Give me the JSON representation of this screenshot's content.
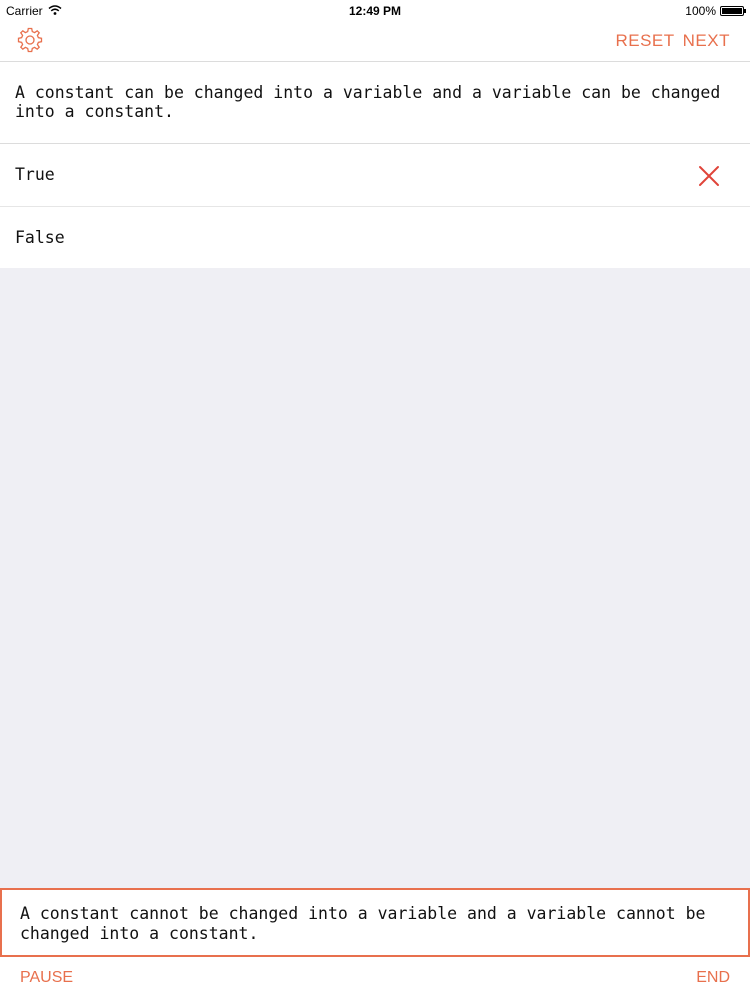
{
  "status_bar": {
    "carrier": "Carrier",
    "time": "12:49 PM",
    "battery": "100%"
  },
  "nav": {
    "settings_icon": "gear-icon",
    "reset_label": "RESET",
    "next_label": "NEXT"
  },
  "question": {
    "text": "A constant can be changed into a variable and a variable can be changed into a constant."
  },
  "options": [
    {
      "label": "True",
      "mark": "wrong"
    },
    {
      "label": "False",
      "mark": ""
    }
  ],
  "answer": {
    "text": "A constant cannot be changed into a variable and a variable cannot be changed into a constant."
  },
  "footer": {
    "pause_label": "PAUSE",
    "end_label": "END"
  },
  "colors": {
    "accent": "#e8704d",
    "wrong_mark": "#e0443a",
    "background": "#efeff4"
  }
}
